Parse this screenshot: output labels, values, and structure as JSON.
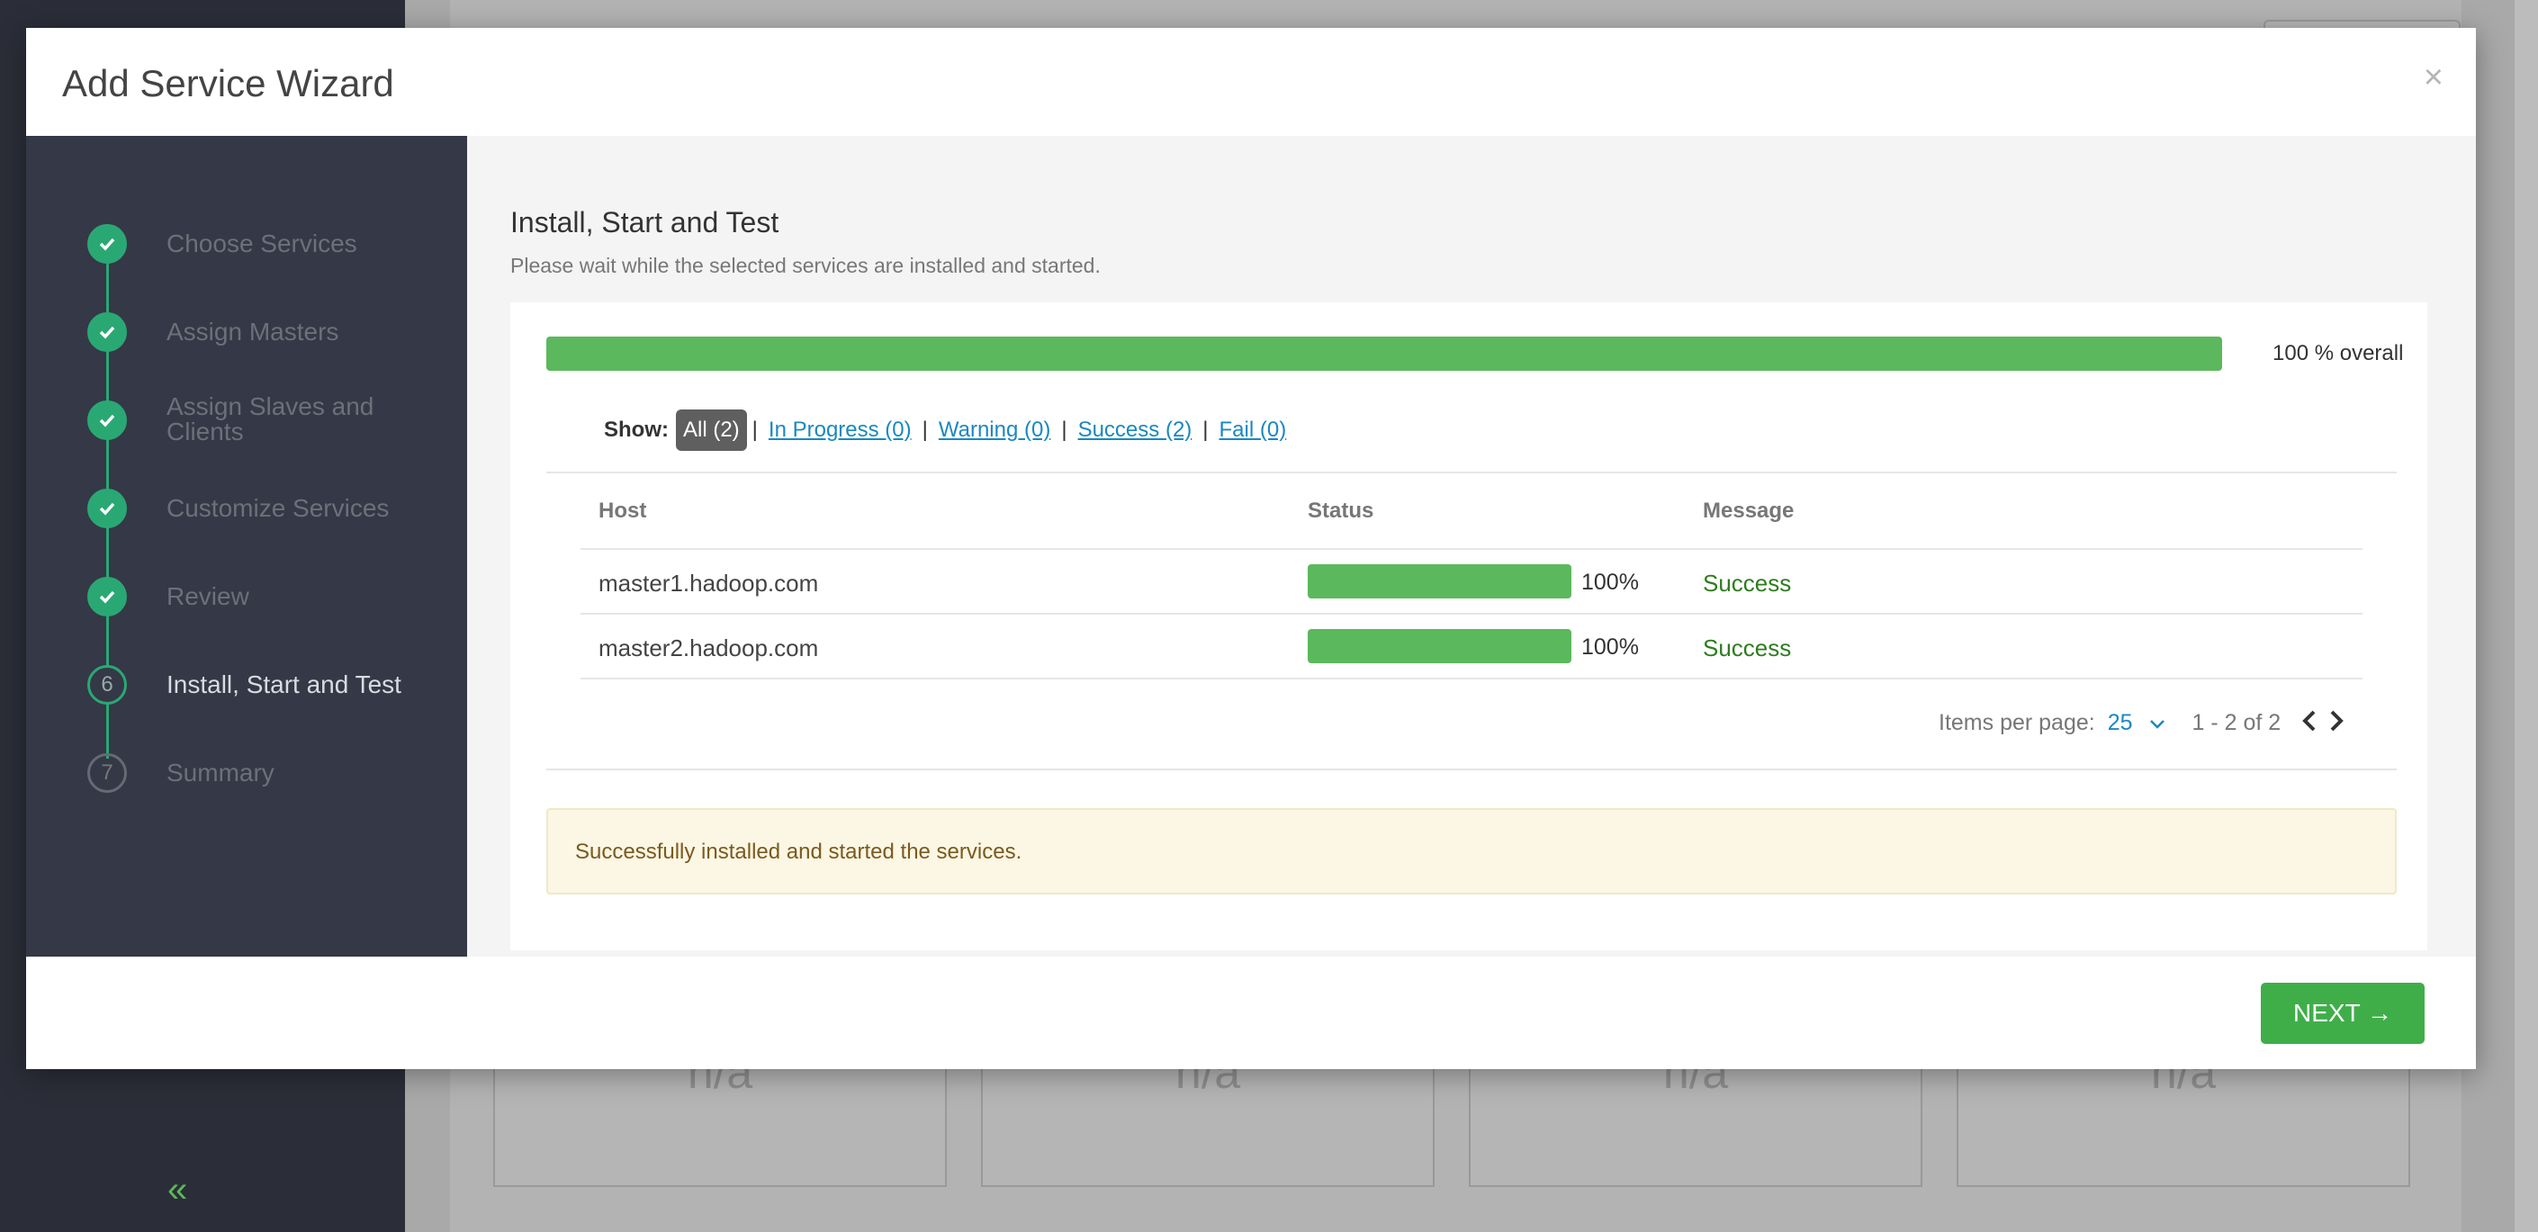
{
  "modal": {
    "title": "Add Service Wizard",
    "close": "×"
  },
  "steps": [
    {
      "number": "1",
      "label": "Choose Services",
      "state": "done"
    },
    {
      "number": "2",
      "label": "Assign Masters",
      "state": "done"
    },
    {
      "number": "3",
      "label": "Assign Slaves and Clients",
      "label_line1": "Assign Slaves and",
      "label_line2": "Clients",
      "state": "done"
    },
    {
      "number": "4",
      "label": "Customize Services",
      "state": "done"
    },
    {
      "number": "5",
      "label": "Review",
      "state": "done"
    },
    {
      "number": "6",
      "label": "Install, Start and Test",
      "state": "current"
    },
    {
      "number": "7",
      "label": "Summary",
      "state": "todo"
    }
  ],
  "content": {
    "title": "Install, Start and Test",
    "subtitle": "Please wait while the selected services are installed and started.",
    "overall_progress": 100,
    "overall_text": "100 % overall"
  },
  "filters": {
    "show_label": "Show:",
    "all": "All (2)",
    "in_progress": "In Progress (0)",
    "warning": "Warning (0)",
    "success": "Success (2)",
    "fail": "Fail (0)",
    "separator": "|"
  },
  "table": {
    "headers": {
      "host": "Host",
      "status": "Status",
      "message": "Message"
    },
    "rows": [
      {
        "host": "master1.hadoop.com",
        "progress": 100,
        "percent": "100%",
        "message": "Success"
      },
      {
        "host": "master2.hadoop.com",
        "progress": 100,
        "percent": "100%",
        "message": "Success"
      }
    ]
  },
  "pager": {
    "label": "Items per page:",
    "per_page": "25",
    "range": "1 - 2 of 2"
  },
  "alert": {
    "text": "Successfully installed and started the services."
  },
  "footer": {
    "next_label": "NEXT →"
  },
  "background": {
    "card_text": "n/a",
    "collapse_icon": "«"
  },
  "colors": {
    "success_green": "#5cb85c",
    "step_green": "#2aa874",
    "link_blue": "#1b88c0",
    "nav_bg": "#353846"
  }
}
